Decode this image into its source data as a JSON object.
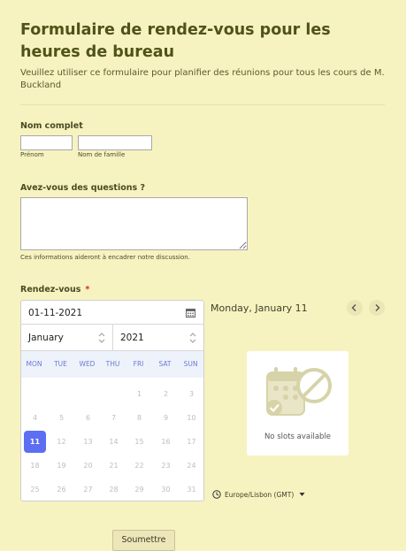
{
  "form": {
    "title": "Formulaire de rendez-vous pour les heures de bureau",
    "subtitle": "Veuillez utiliser ce formulaire pour planifier des réunions pour tous les cours de M. Buckland"
  },
  "name_field": {
    "label": "Nom complet",
    "first_sublabel": "Prénom",
    "last_sublabel": "Nom de famille",
    "first_value": "",
    "last_value": ""
  },
  "questions_field": {
    "label": "Avez-vous des questions ?",
    "value": "",
    "hint": "Ces informations aideront à encadrer notre discussion."
  },
  "appointment": {
    "label": "Rendez-vous",
    "required_mark": "*",
    "date_value": "01-11-2021",
    "month": "January",
    "year": "2021",
    "weekdays": [
      "MON",
      "TUE",
      "WED",
      "THU",
      "FRI",
      "SAT",
      "SUN"
    ],
    "days": [
      [
        "",
        "",
        "",
        "",
        "1",
        "2",
        "3"
      ],
      [
        "4",
        "5",
        "6",
        "7",
        "8",
        "9",
        "10"
      ],
      [
        "11",
        "12",
        "13",
        "14",
        "15",
        "16",
        "17"
      ],
      [
        "18",
        "19",
        "20",
        "21",
        "22",
        "23",
        "24"
      ],
      [
        "25",
        "26",
        "27",
        "28",
        "29",
        "30",
        "31"
      ]
    ],
    "selected_day": "11",
    "day_title": "Monday, January 11",
    "no_slots": "No slots available",
    "timezone": "Europe/Lisbon (GMT)"
  },
  "icons": {
    "calendar": "calendar-icon",
    "prev": "chevron-left-icon",
    "next": "chevron-right-icon",
    "clock": "clock-icon",
    "no_slots": "no-slots-calendar-icon"
  },
  "colors": {
    "background": "#f7f3c0",
    "title": "#4f5319",
    "accent": "#5c6ef2",
    "required": "#d8243a"
  },
  "submit_label": "Soumettre"
}
